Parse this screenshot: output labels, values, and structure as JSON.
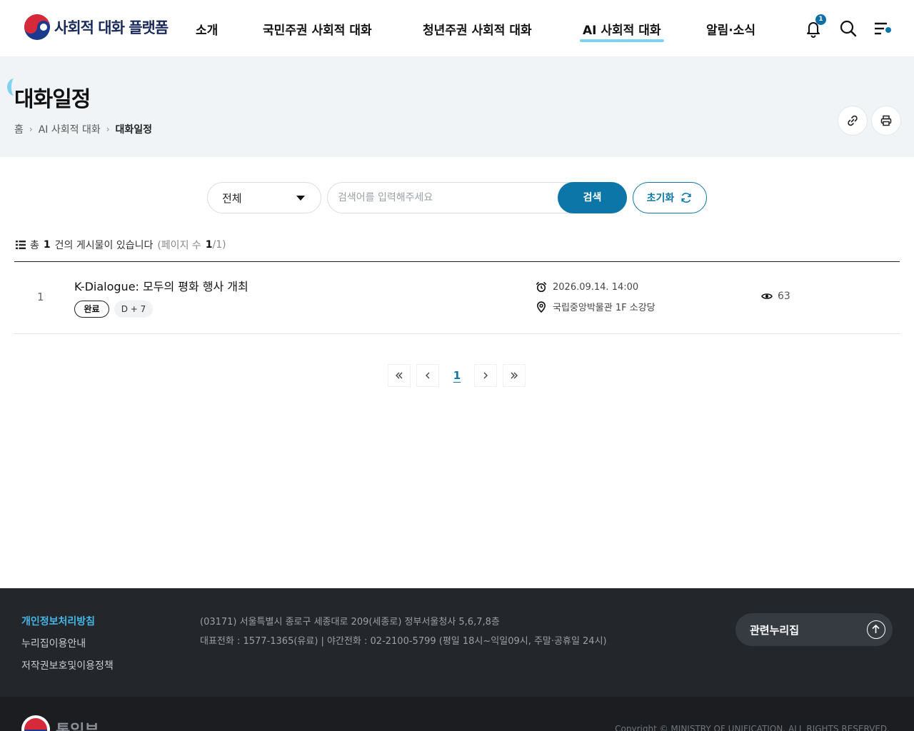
{
  "header": {
    "logo_text": "사회적 대화 플랫폼",
    "nav": [
      "소개",
      "국민주권 사회적 대화",
      "청년주권 사회적 대화",
      "AI 사회적 대화",
      "알림·소식"
    ],
    "notification_count": "1"
  },
  "page": {
    "title": "대화일정",
    "breadcrumb": [
      "홈",
      "AI 사회적 대화",
      "대화일정"
    ]
  },
  "search": {
    "category_selected": "전체",
    "placeholder": "검색어를 입력해주세요",
    "value": "",
    "search_label": "검색",
    "reset_label": "초기화"
  },
  "summary": {
    "prefix": "총",
    "total": "1",
    "suffix": "건의 게시물이 있습니다",
    "page_open": "(페이지 수",
    "page_current": "1",
    "page_rest": "/1)"
  },
  "rows": [
    {
      "number": "1",
      "title": "K-Dialogue: 모두의 평화 행사 개최",
      "status": "완료",
      "dday": "D + 7",
      "datetime": "2026.09.14. 14:00",
      "location": "국립중앙박물관 1F 소강당",
      "views": "63"
    }
  ],
  "pagination": {
    "current": "1"
  },
  "footer": {
    "links": [
      "개인정보처리방침",
      "누리집이용안내",
      "저작권보호및이용정책"
    ],
    "address": "(03171) 서울특별시 종로구 세종대로 209(세종로) 정부서울청사 5,6,7,8층",
    "phone": "대표전화 : 1577-1365(유료)  |  야간전화 : 02-2100-5799 (평일 18시~익일09시, 주말·공휴일 24시)",
    "related_label": "관련누리집",
    "org_name": "통일부",
    "copyright": "Copyright © MINISTRY OF UNIFICATION. ALL RIGHTS RESERVED."
  },
  "colors": {
    "primary": "#0d76a8",
    "accent": "#7fd3ef",
    "footer_bg": "#23262b",
    "footer_link_primary": "#46b6e6"
  }
}
